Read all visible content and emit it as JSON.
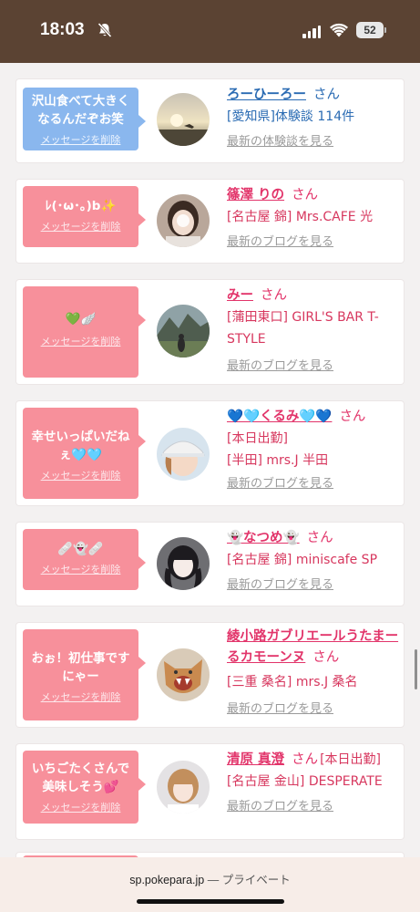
{
  "status_bar": {
    "time": "18:03",
    "battery": "52"
  },
  "cards": [
    {
      "bubble_text": "沢山食べて大きくなるんだぞお笑",
      "delete_label": "メッセージを削除",
      "theme": "blue",
      "name": "ろーひーろー",
      "honorific": "さん",
      "lines": [
        "[愛知県]体験談 114件"
      ],
      "link": "最新の体験談を見る",
      "avatar_icon": "sunset-photo"
    },
    {
      "bubble_text": "ﾚ(･ω･｡)b✨",
      "delete_label": "メッセージを削除",
      "theme": "pink",
      "name": "篠澤 りの",
      "honorific": "さん",
      "lines": [
        "[名古屋 錦] Mrs.CAFE 光"
      ],
      "link": "最新のブログを見る",
      "avatar_icon": "short-hair-portrait"
    },
    {
      "bubble_text": "💚🪽",
      "delete_label": "メッセージを削除",
      "theme": "pink",
      "name": "みー",
      "honorific": "さん",
      "lines": [
        "[蒲田東口] GIRL'S BAR T-STYLE"
      ],
      "link": "最新のブログを見る",
      "avatar_icon": "mountain-photo"
    },
    {
      "bubble_text": "幸せいっぱいだねぇ🩵🩵",
      "delete_label": "メッセージを削除",
      "theme": "pink",
      "name": "💙🩵くるみ🩵💙",
      "honorific": "さん",
      "lines": [
        "[本日出勤]",
        "[半田] mrs.J 半田"
      ],
      "link": "最新のブログを見る",
      "avatar_icon": "cap-portrait"
    },
    {
      "bubble_text": "🩹👻🩹",
      "delete_label": "メッセージを削除",
      "theme": "pink",
      "name": "👻なつめ👻",
      "honorific": "さん",
      "lines": [
        "[名古屋 錦] miniscafe SP"
      ],
      "link": "最新のブログを見る",
      "avatar_icon": "twin-tail-portrait"
    },
    {
      "bubble_text": "おぉ！初仕事ですにゃー",
      "delete_label": "メッセージを削除",
      "theme": "pink",
      "name": "綾小路ガブリエールうたまーるカモーンヌ",
      "honorific": "さん",
      "lines": [
        "[三重 桑名] mrs.J 桑名"
      ],
      "link": "最新のブログを見る",
      "avatar_icon": "cat-photo"
    },
    {
      "bubble_text": "いちごたくさんで美味しそう💕",
      "delete_label": "メッセージを削除",
      "theme": "pink",
      "name": "清原 真澄",
      "honorific": "さん",
      "inline_extra": "[本日出勤]",
      "lines": [
        "[名古屋 金山] DESPERATE"
      ],
      "link": "最新のブログを見る",
      "avatar_icon": "bob-hair-portrait"
    }
  ],
  "browser": {
    "domain": "sp.pokepara.jp",
    "separator": "—",
    "mode": "プライベート"
  }
}
